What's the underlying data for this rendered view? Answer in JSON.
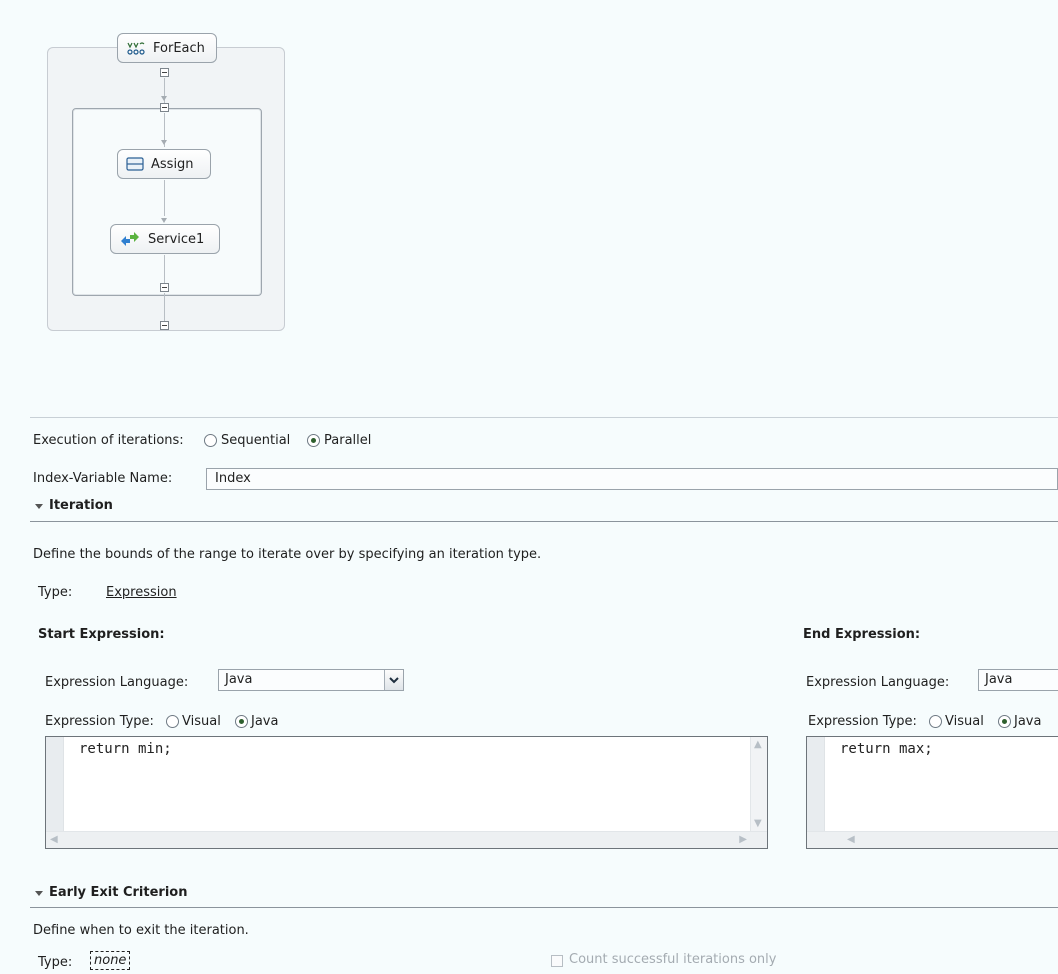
{
  "diagram": {
    "foreach_label": "ForEach",
    "assign_label": "Assign",
    "service_label": "Service1"
  },
  "properties": {
    "execution": {
      "label": "Execution of iterations:",
      "options": [
        "Sequential",
        "Parallel"
      ],
      "selected": "Parallel"
    },
    "index_variable": {
      "label": "Index-Variable Name:",
      "value": "Index"
    },
    "iteration": {
      "title": "Iteration",
      "description": "Define the bounds of the range to iterate over by specifying an iteration type.",
      "type_label": "Type:",
      "type_value": "Expression",
      "start": {
        "title": "Start Expression:",
        "language_label": "Expression Language:",
        "language_value": "Java",
        "type_label": "Expression Type:",
        "type_options": [
          "Visual",
          "Java"
        ],
        "type_selected": "Java",
        "code": "return min;"
      },
      "end": {
        "title": "End Expression:",
        "language_label": "Expression Language:",
        "language_value": "Java",
        "type_label": "Expression Type:",
        "type_options": [
          "Visual",
          "Java"
        ],
        "type_selected": "Java",
        "code": "return max;"
      }
    },
    "early_exit": {
      "title": "Early Exit Criterion",
      "description": "Define when to exit the iteration.",
      "type_label": "Type:",
      "type_value": "none",
      "count_checkbox_label": "Count successful iterations only",
      "count_checked": false
    }
  },
  "colors": {
    "background": "#f7fbfc",
    "radio_selected": "#2d5f2d",
    "border": "#9aa3ab"
  },
  "icons": {
    "foreach": "foreach-icon",
    "assign": "assign-icon",
    "service": "service-invoke-icon",
    "collapse": "collapse-minus-icon",
    "dropdown": "chevron-down-icon"
  }
}
